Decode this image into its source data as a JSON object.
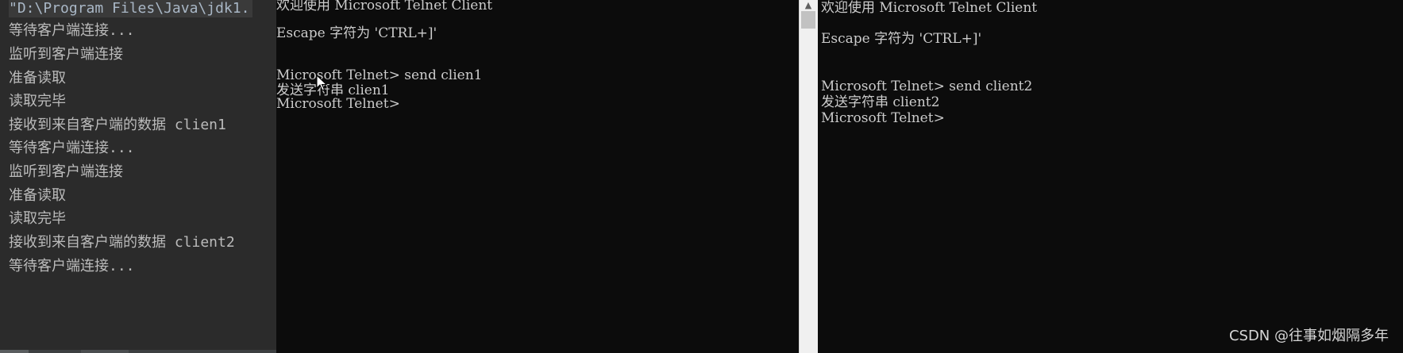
{
  "ide_console": {
    "command_line": "\"D:\\Program Files\\Java\\jdk1.",
    "lines": [
      "等待客户端连接...",
      "监听到客户端连接",
      "准备读取",
      "读取完毕",
      "接收到来自客户端的数据 clien1",
      "等待客户端连接...",
      "监听到客户端连接",
      "准备读取",
      "读取完毕",
      "接收到来自客户端的数据 client2",
      "等待客户端连接..."
    ]
  },
  "telnet1": {
    "welcome": "欢迎使用 Microsoft Telnet Client",
    "escape": "Escape 字符为 'CTRL+]'",
    "command": "Microsoft Telnet> send clien1",
    "result": "发送字符串 clien1",
    "prompt": "Microsoft Telnet>"
  },
  "telnet2": {
    "welcome": "欢迎使用 Microsoft Telnet Client",
    "escape": "Escape 字符为 'CTRL+]'",
    "command": "Microsoft Telnet> send client2",
    "result": "发送字符串 client2",
    "prompt": "Microsoft Telnet>"
  },
  "scrollbar": {
    "up_arrow_icon": "chevron-up-icon"
  },
  "watermark": "CSDN @往事如烟隔多年",
  "colors": {
    "ide_background": "#2b2b2b",
    "ide_text": "#bbbbbb",
    "terminal_background": "#0c0c0c",
    "terminal_text": "#cccccc",
    "watermark": "#d6d6d6"
  }
}
